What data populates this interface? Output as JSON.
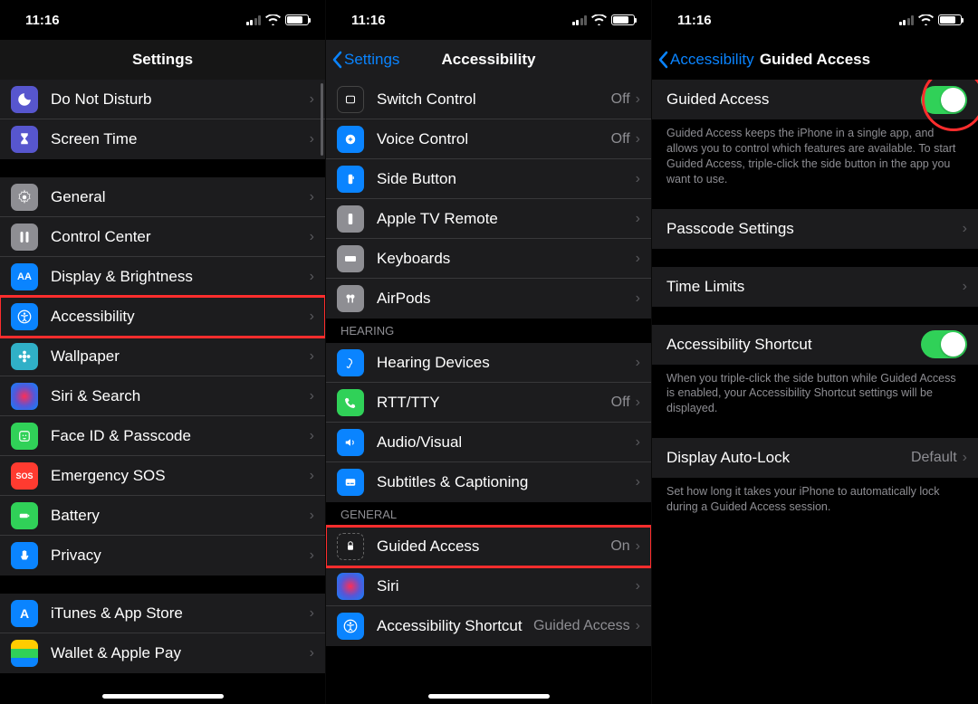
{
  "status": {
    "time": "11:16"
  },
  "pane1": {
    "title": "Settings",
    "groups": [
      {
        "rows": [
          {
            "label": "Do Not Disturb",
            "icon": "moon"
          },
          {
            "label": "Screen Time",
            "icon": "hourglass"
          }
        ]
      },
      {
        "rows": [
          {
            "label": "General",
            "icon": "gear"
          },
          {
            "label": "Control Center",
            "icon": "sliders"
          },
          {
            "label": "Display & Brightness",
            "icon": "AA"
          },
          {
            "label": "Accessibility",
            "icon": "person",
            "highlight": true
          },
          {
            "label": "Wallpaper",
            "icon": "flower"
          },
          {
            "label": "Siri & Search",
            "icon": "siri"
          },
          {
            "label": "Face ID & Passcode",
            "icon": "face"
          },
          {
            "label": "Emergency SOS",
            "icon": "SOS"
          },
          {
            "label": "Battery",
            "icon": "batt"
          },
          {
            "label": "Privacy",
            "icon": "hand"
          }
        ]
      },
      {
        "rows": [
          {
            "label": "iTunes & App Store",
            "icon": "A"
          },
          {
            "label": "Wallet & Apple Pay",
            "icon": "wallet"
          }
        ]
      }
    ]
  },
  "pane2": {
    "back": "Settings",
    "title": "Accessibility",
    "topRows": [
      {
        "label": "Switch Control",
        "value": "Off"
      },
      {
        "label": "Voice Control",
        "value": "Off"
      },
      {
        "label": "Side Button"
      },
      {
        "label": "Apple TV Remote"
      },
      {
        "label": "Keyboards"
      },
      {
        "label": "AirPods"
      }
    ],
    "hearingHeader": "HEARING",
    "hearingRows": [
      {
        "label": "Hearing Devices"
      },
      {
        "label": "RTT/TTY",
        "value": "Off"
      },
      {
        "label": "Audio/Visual"
      },
      {
        "label": "Subtitles & Captioning"
      }
    ],
    "generalHeader": "GENERAL",
    "generalRows": [
      {
        "label": "Guided Access",
        "value": "On",
        "highlight": true
      },
      {
        "label": "Siri"
      },
      {
        "label": "Accessibility Shortcut",
        "value": "Guided Access"
      }
    ]
  },
  "pane3": {
    "back": "Accessibility",
    "title": "Guided Access",
    "mainToggle": {
      "label": "Guided Access",
      "on": true,
      "circle": true
    },
    "mainFooter": "Guided Access keeps the iPhone in a single app, and allows you to control which features are available. To start Guided Access, triple-click the side button in the app you want to use.",
    "rows2": [
      {
        "label": "Passcode Settings"
      }
    ],
    "rows3": [
      {
        "label": "Time Limits"
      }
    ],
    "shortcutToggle": {
      "label": "Accessibility Shortcut",
      "on": true
    },
    "shortcutFooter": "When you triple-click the side button while Guided Access is enabled, your Accessibility Shortcut settings will be displayed.",
    "autolock": {
      "label": "Display Auto-Lock",
      "value": "Default"
    },
    "autolockFooter": "Set how long it takes your iPhone to automatically lock during a Guided Access session."
  }
}
